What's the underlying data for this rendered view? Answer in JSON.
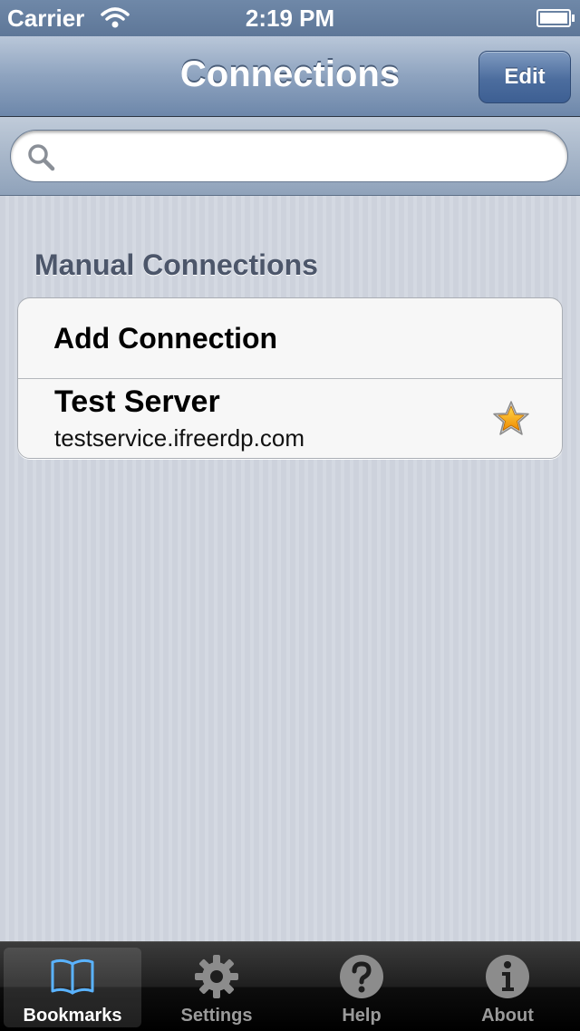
{
  "status_bar": {
    "carrier": "Carrier",
    "time": "2:19 PM",
    "battery_level": 1.0
  },
  "nav": {
    "title": "Connections",
    "edit_label": "Edit"
  },
  "search": {
    "value": "",
    "placeholder": ""
  },
  "section": {
    "header": "Manual Connections"
  },
  "list": {
    "add_label": "Add Connection",
    "items": [
      {
        "title": "Test Server",
        "subtitle": "testservice.ifreerdp.com",
        "icon": "star-icon"
      }
    ]
  },
  "tab_bar": {
    "tabs": [
      {
        "label": "Bookmarks",
        "icon": "book-icon",
        "active": true
      },
      {
        "label": "Settings",
        "icon": "gear-icon",
        "active": false
      },
      {
        "label": "Help",
        "icon": "question-icon",
        "active": false
      },
      {
        "label": "About",
        "icon": "info-icon",
        "active": false
      }
    ]
  },
  "colors": {
    "nav_bar": "#8ea3bf",
    "accent_blue": "#4c6d9e",
    "tab_active_icon": "#5ab3ff"
  }
}
